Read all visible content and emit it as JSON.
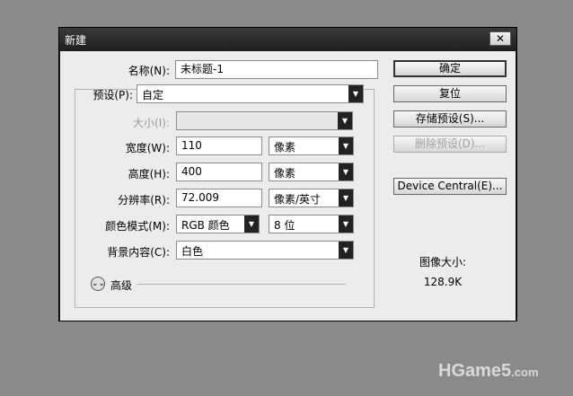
{
  "dialog": {
    "title": "新建",
    "close_glyph": "✕",
    "fields": {
      "name": {
        "label": "名称(N):",
        "value": "未标题-1"
      },
      "preset": {
        "label": "预设(P):",
        "value": "自定"
      },
      "size": {
        "label": "大小(I):",
        "value": ""
      },
      "width": {
        "label": "宽度(W):",
        "value": "110",
        "unit": "像素"
      },
      "height": {
        "label": "高度(H):",
        "value": "400",
        "unit": "像素"
      },
      "resolution": {
        "label": "分辨率(R):",
        "value": "72.009",
        "unit": "像素/英寸"
      },
      "color_mode": {
        "label": "颜色模式(M):",
        "value": "RGB 颜色",
        "depth": "8 位"
      },
      "background": {
        "label": "背景内容(C):",
        "value": "白色"
      }
    },
    "advanced_label": "高级",
    "advanced_icon": "double-chevron-down-icon",
    "buttons": {
      "ok": "确定",
      "reset": "复位",
      "save_preset": "存储预设(S)...",
      "delete_preset": "删除预设(D)...",
      "device_central": "Device Central(E)..."
    },
    "image_size_label": "图像大小:",
    "image_size_value": "128.9K"
  },
  "watermark": {
    "main": "HGame5",
    "suffix": ".com"
  },
  "colors": {
    "background": "#8a8a8a",
    "titlebar": "#202020",
    "dialog_body": "#ececec"
  }
}
